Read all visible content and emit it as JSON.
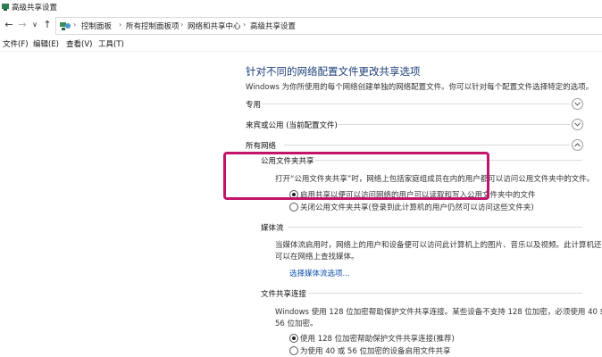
{
  "window": {
    "title": "高级共享设置"
  },
  "address": {
    "crumbs": [
      "控制面板",
      "所有控制面板项",
      "网络和共享中心",
      "高级共享设置"
    ],
    "back_glyph": "←",
    "forward_glyph": "→",
    "recent_glyph": "∨",
    "up_glyph": "↑"
  },
  "menu": {
    "items": [
      "文件(F)",
      "编辑(E)",
      "查看(V)",
      "工具(T)"
    ]
  },
  "main": {
    "title": "针对不同的网络配置文件更改共享选项",
    "description": "Windows 为你所使用的每个网络创建单独的网络配置文件。你可以针对每个配置文件选择特定的选项。",
    "profiles": {
      "private": "专用",
      "guest_public": "来宾或公用 (当前配置文件)",
      "all_networks": "所有网络"
    },
    "public_folder": {
      "heading": "公用文件夹共享",
      "desc": "打开“公用文件夹共享”时，网络上包括家庭组成员在内的用户都可以访问公用文件夹中的文件。",
      "option_on": "启用共享以便可以访问网络的用户可以读取和写入公用文件夹中的文件",
      "option_off": "关闭公用文件夹共享(登录到此计算机的用户仍然可以访问这些文件夹)"
    },
    "media": {
      "heading": "媒体流",
      "desc_line1": "当媒体流启用时，网络上的用户和设备便可以访问此计算机上的图片、音乐以及视频。此计算机还",
      "desc_line2": "可以在网络上查找媒体。",
      "link": "选择媒体流选项..."
    },
    "file_sharing": {
      "heading": "文件共享连接",
      "desc_line1": "Windows 使用 128 位加密帮助保护文件共享连接。某些设备不支持 128 位加密，必须使用 40 或",
      "desc_line2": "56 位加密。",
      "option_128": "使用 128 位加密帮助保护文件共享连接(推荐)",
      "option_40_56": "为使用 40 或 56 位加密的设备启用文件共享"
    }
  }
}
